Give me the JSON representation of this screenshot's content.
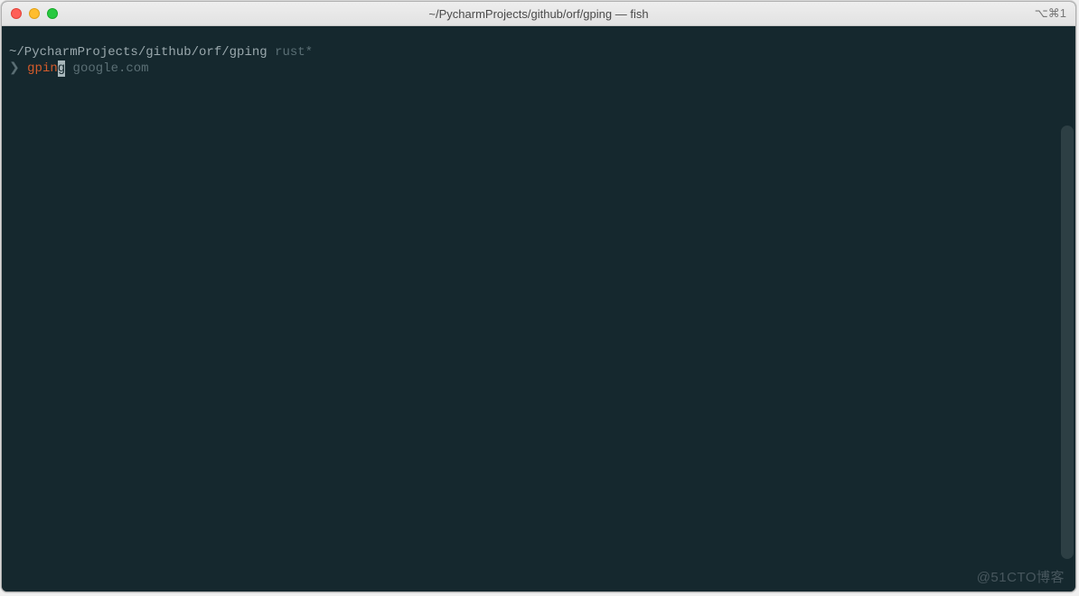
{
  "titlebar": {
    "title": "~/PycharmProjects/github/orf/gping — fish",
    "shortcut": "⌥⌘1"
  },
  "terminal": {
    "cwd_path": "~/PycharmProjects/github/orf/gping",
    "branch": "rust*",
    "prompt_symbol": "❯",
    "typed_command": "gpin",
    "cursor_char": "g",
    "suggestion_rest": " google.com"
  },
  "watermark": "@51CTO博客"
}
